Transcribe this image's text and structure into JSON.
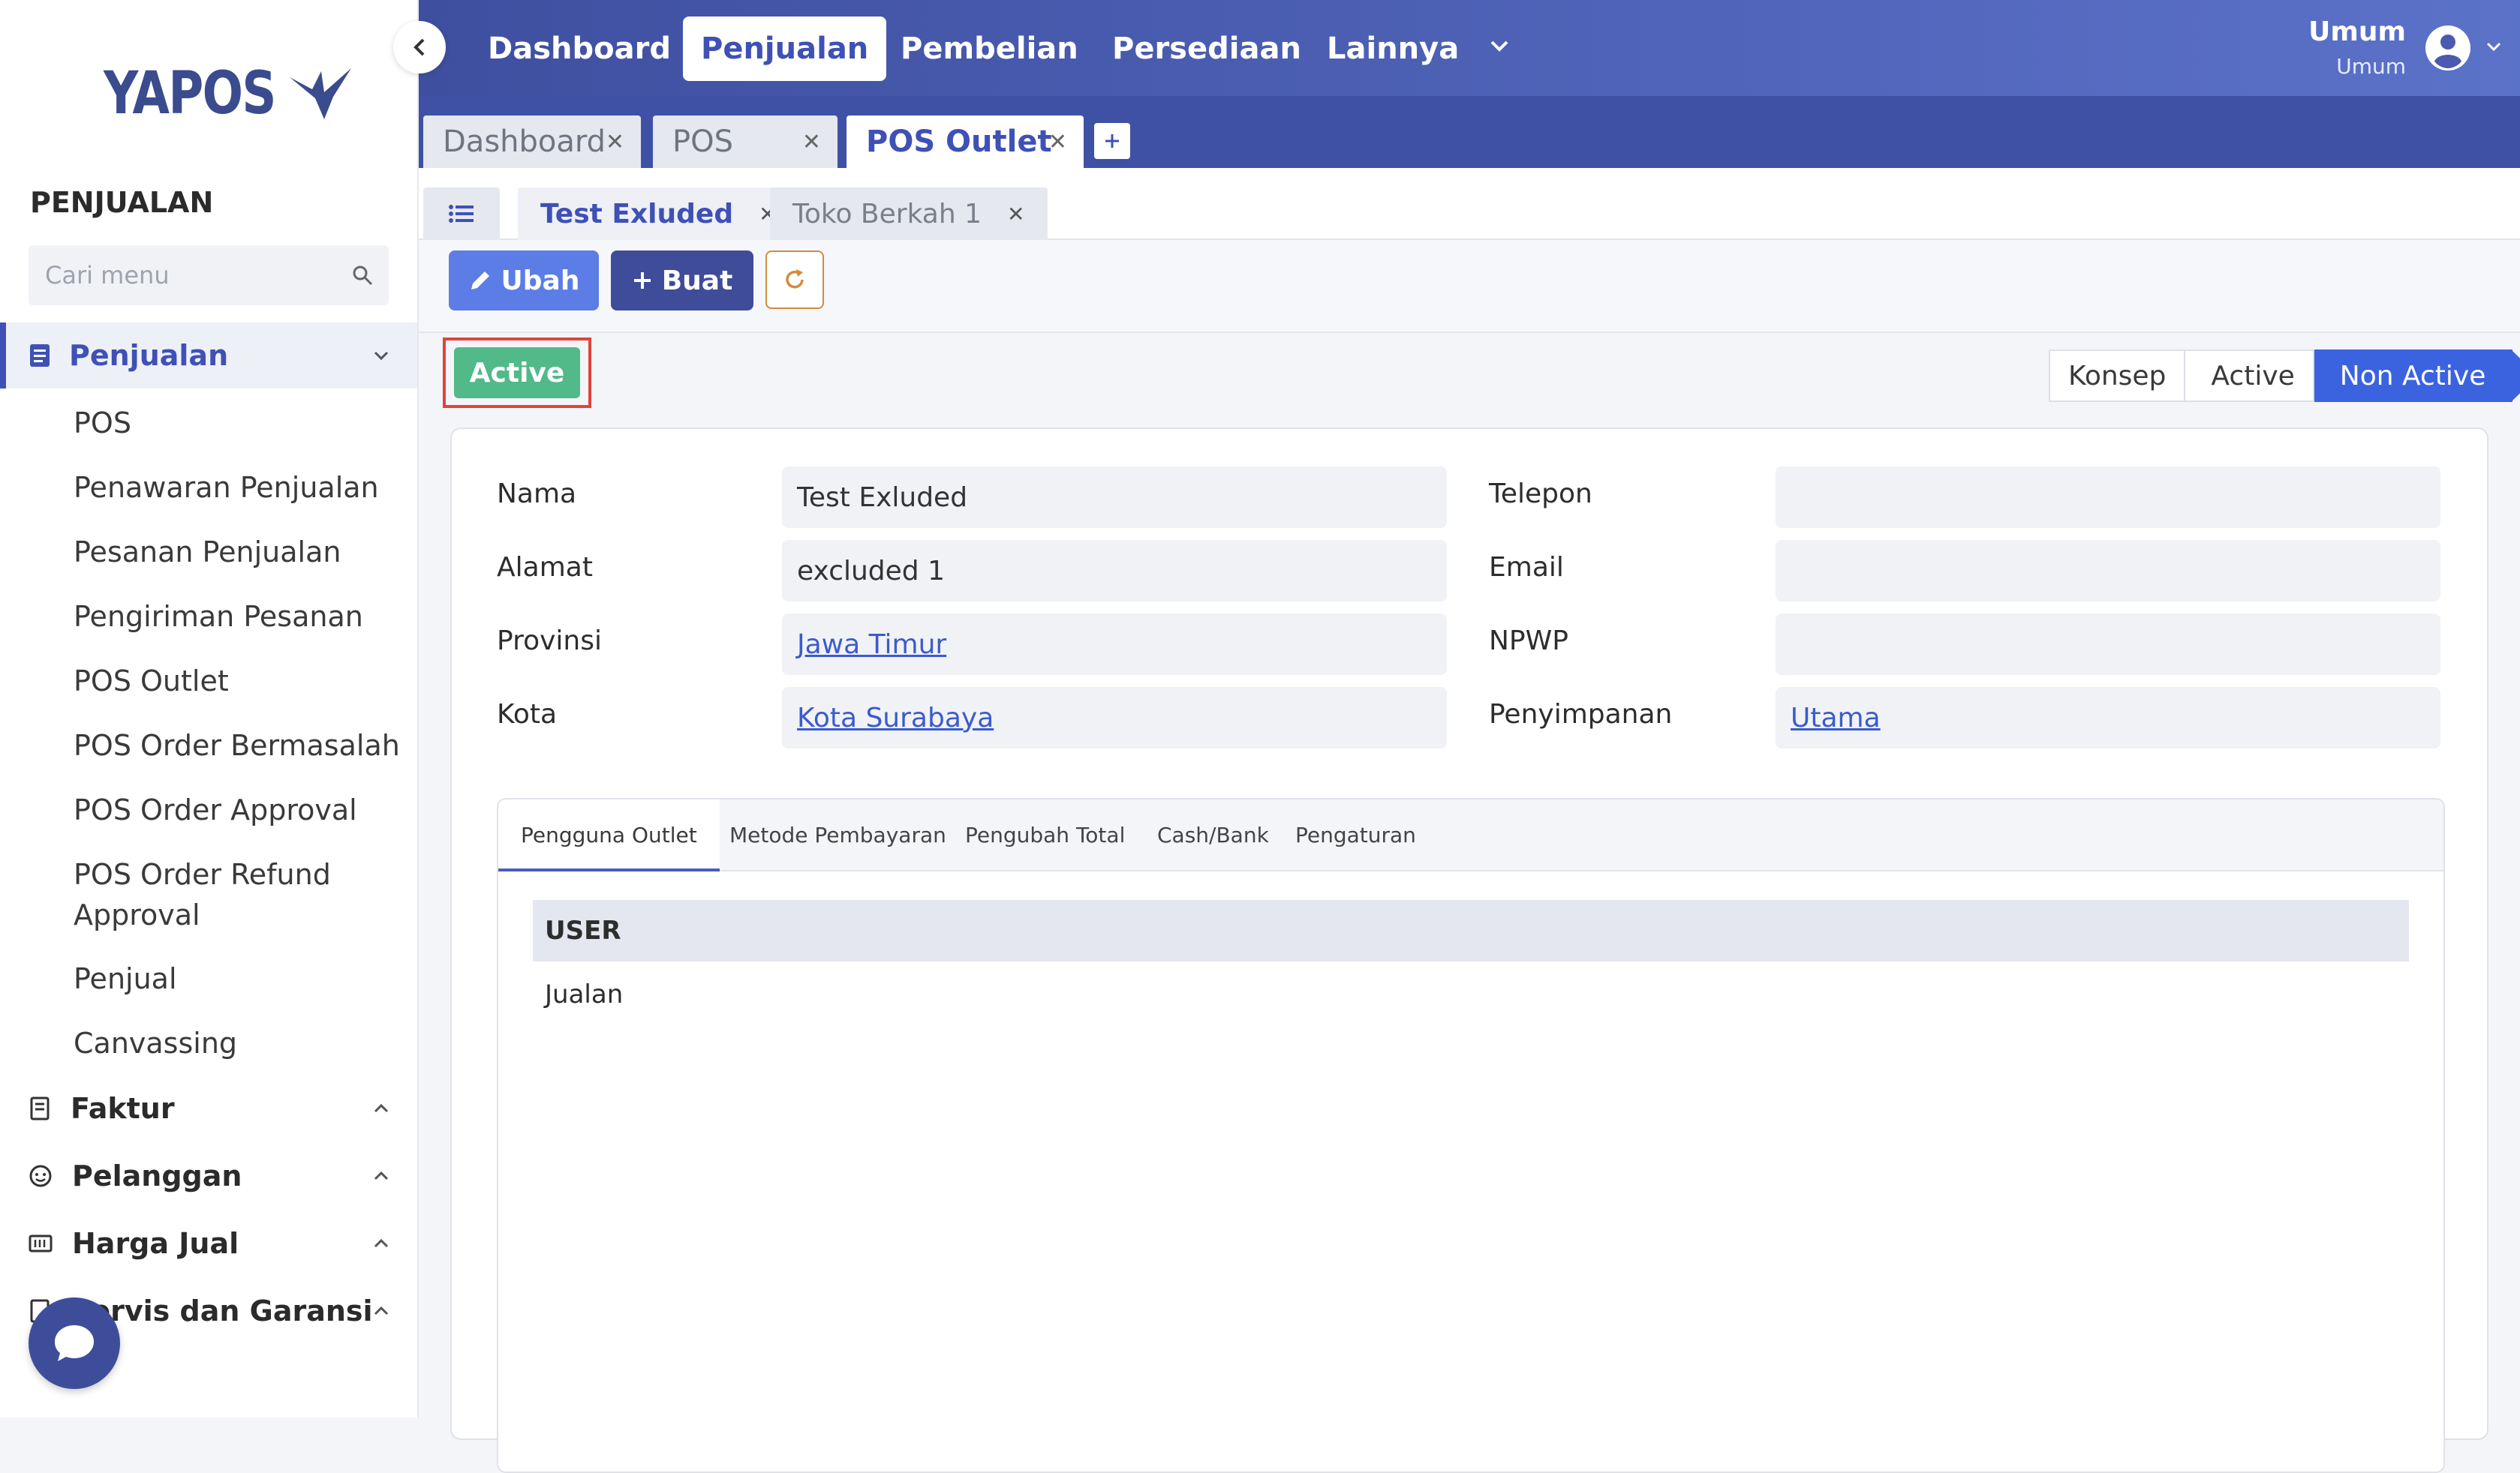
{
  "app": {
    "logo_text": "YAPOS"
  },
  "sidebar": {
    "heading": "PENJUALAN",
    "search_placeholder": "Cari menu",
    "active_group": "Penjualan",
    "items": [
      "POS",
      "Penawaran Penjualan",
      "Pesanan Penjualan",
      "Pengiriman Pesanan",
      "POS Outlet",
      "POS Order Bermasalah",
      "POS Order Approval",
      "POS Order Refund Approval",
      "Penjual",
      "Canvassing"
    ],
    "groups": [
      "Faktur",
      "Pelanggan",
      "Harga Jual",
      "Servis dan Garansi"
    ]
  },
  "topnav": {
    "items": [
      "Dashboard",
      "Penjualan",
      "Pembelian",
      "Persediaan",
      "Lainnya"
    ],
    "active": "Penjualan",
    "user_name": "Umum",
    "user_role": "Umum"
  },
  "window_tabs": [
    "Dashboard",
    "POS",
    "POS Outlet"
  ],
  "sub_tabs": [
    "Test Exluded",
    "Toko Berkah 1"
  ],
  "toolbar": {
    "edit_label": "Ubah",
    "create_label": "Buat"
  },
  "status": {
    "current": "Active",
    "stages": [
      "Konsep",
      "Active",
      "Non Active"
    ]
  },
  "form": {
    "nama_label": "Nama",
    "nama_value": "Test Exluded",
    "alamat_label": "Alamat",
    "alamat_value": "excluded 1",
    "provinsi_label": "Provinsi",
    "provinsi_value": "Jawa Timur",
    "kota_label": "Kota",
    "kota_value": "Kota Surabaya",
    "telepon_label": "Telepon",
    "telepon_value": "",
    "email_label": "Email",
    "email_value": "",
    "npwp_label": "NPWP",
    "npwp_value": "",
    "penyimpanan_label": "Penyimpanan",
    "penyimpanan_value": "Utama"
  },
  "panel": {
    "tabs": [
      "Pengguna Outlet",
      "Metode Pembayaran",
      "Pengubah Total",
      "Cash/Bank",
      "Pengaturan"
    ],
    "column_header": "USER",
    "rows": [
      "Jualan"
    ]
  },
  "colors": {
    "primary": "#3f51b5",
    "success": "#52b989",
    "highlight": "#e0443a"
  }
}
